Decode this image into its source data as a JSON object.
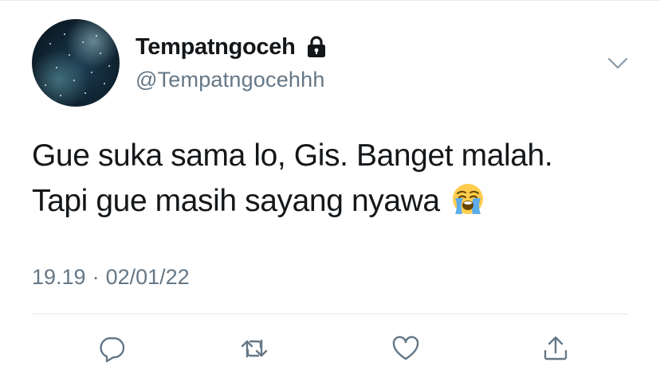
{
  "colors": {
    "text_primary": "#14171a",
    "text_secondary": "#657786",
    "icon": "#657786",
    "divider": "#e1e8ed"
  },
  "tweet": {
    "author": {
      "display_name": "Tempatngoceh",
      "handle": "@Tempatngocehhh",
      "protected_icon": "lock-icon",
      "avatar": "avatar"
    },
    "text_lines": [
      "Gue suka sama lo, Gis. Banget malah.",
      "Tapi gue masih sayang nyawa"
    ],
    "emoji": "loudly-crying-face-emoji",
    "time": "19.19",
    "separator": "·",
    "date": "02/01/22",
    "menu_icon": "chevron-down-icon",
    "actions": [
      {
        "name": "reply",
        "icon": "reply-icon"
      },
      {
        "name": "retweet",
        "icon": "retweet-icon"
      },
      {
        "name": "like",
        "icon": "heart-icon"
      },
      {
        "name": "share",
        "icon": "share-icon"
      }
    ]
  }
}
